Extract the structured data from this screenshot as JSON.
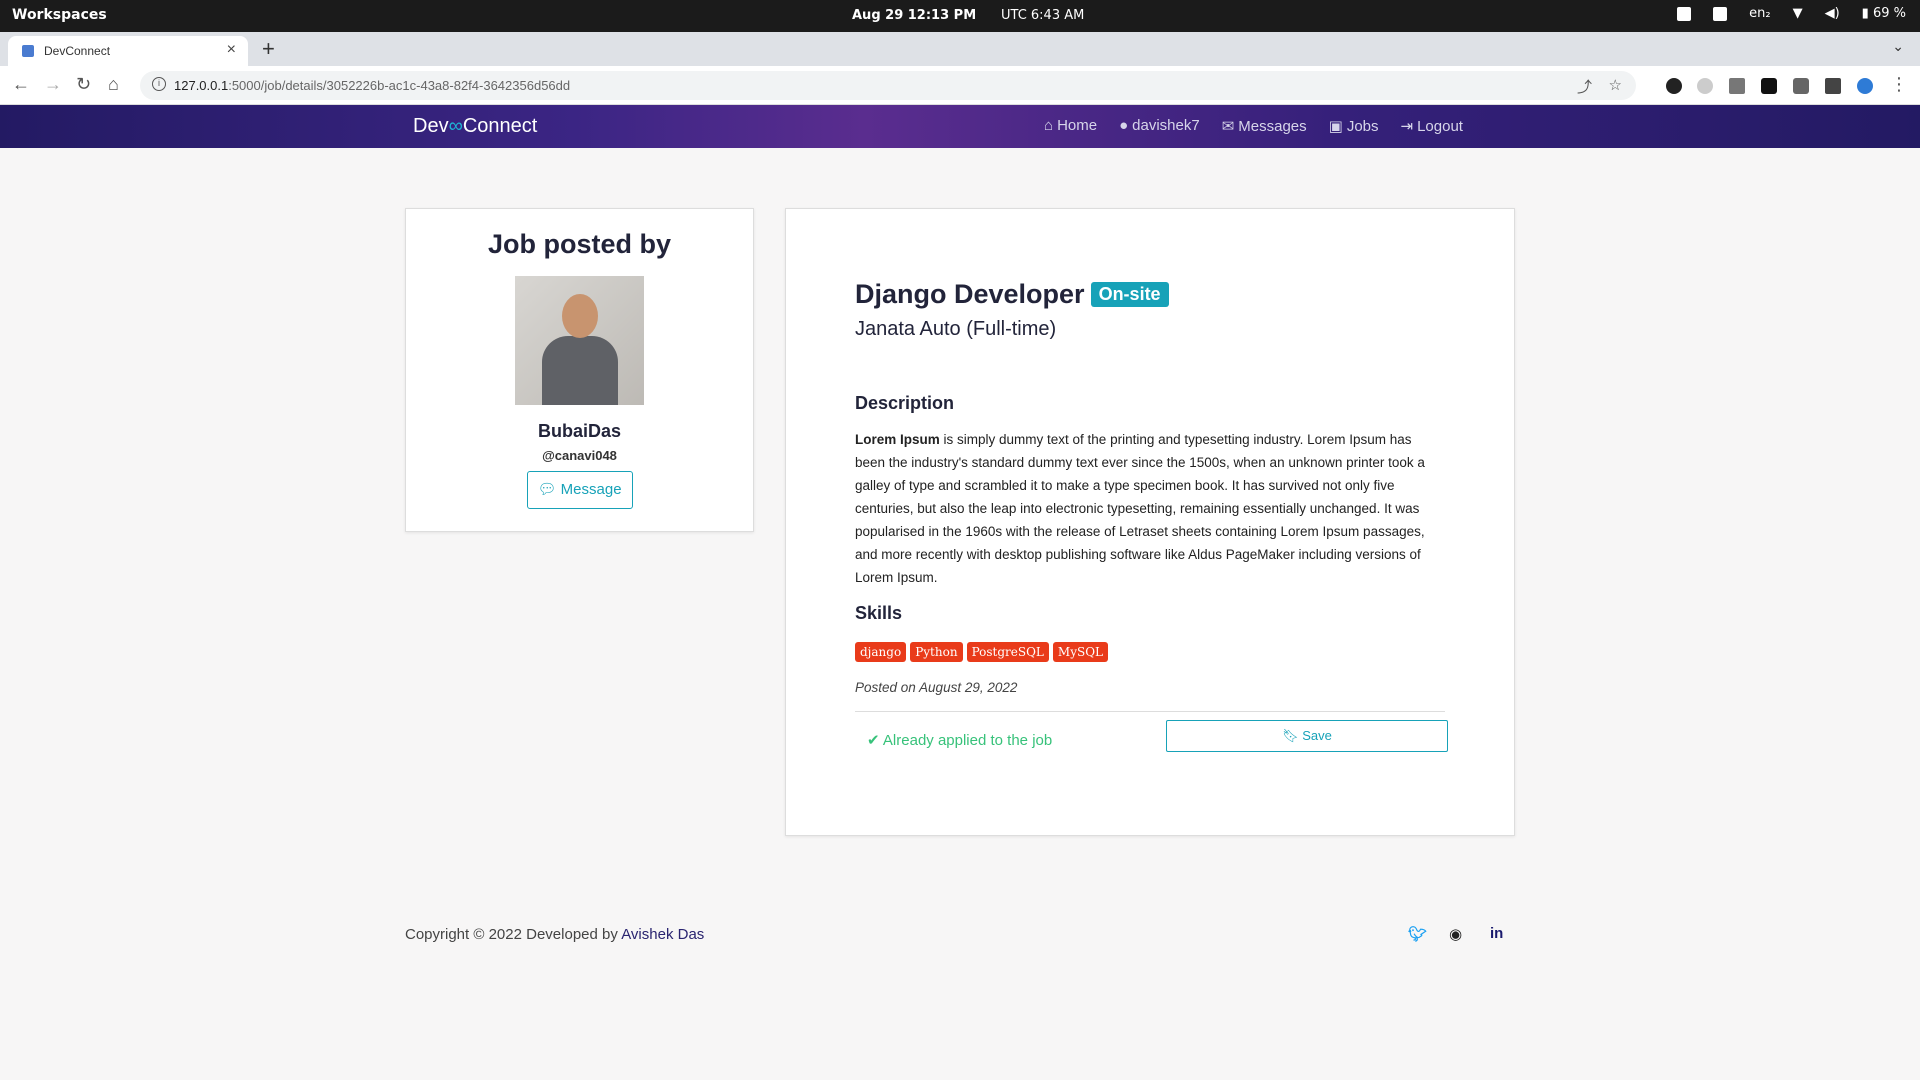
{
  "os": {
    "workspaces": "Workspaces",
    "date": "Aug 29  12:13 PM",
    "utc": "UTC 6:43 AM",
    "lang": "en₂",
    "battery": "69 %"
  },
  "browser": {
    "tab_title": "DevConnect",
    "url_host": "127.0.0.1",
    "url_rest": ":5000/job/details/3052226b-ac1c-43a8-82f4-3642356d56dd"
  },
  "site": {
    "brand_left": "Dev",
    "brand_right": "Connect",
    "nav": [
      "Home",
      "davishek7",
      "Messages",
      "Jobs",
      "Logout"
    ]
  },
  "poster": {
    "heading": "Job posted by",
    "name": "BubaiDas",
    "handle": "@canavi048",
    "message_label": "Message"
  },
  "job": {
    "title": "Django Developer",
    "work_mode": "On-site",
    "company": "Janata Auto (Full-time)",
    "description_heading": "Description",
    "description_lead": "Lorem Ipsum",
    "description_body": " is simply dummy text of the printing and typesetting industry. Lorem Ipsum has been the industry's standard dummy text ever since the 1500s, when an unknown printer took a galley of type and scrambled it to make a type specimen book. It has survived not only five centuries, but also the leap into electronic typesetting, remaining essentially unchanged. It was popularised in the 1960s with the release of Letraset sheets containing Lorem Ipsum passages, and more recently with desktop publishing software like Aldus PageMaker including versions of Lorem Ipsum.",
    "skills_heading": "Skills",
    "skills": [
      "django",
      "Python",
      "PostgreSQL",
      "MySQL"
    ],
    "posted": "Posted on August 29, 2022",
    "applied_status": "Already applied to the job",
    "save_label": "Save"
  },
  "footer": {
    "copyright": "Copyright © 2022 Developed by ",
    "author": "Avishek Das"
  },
  "colors": {
    "accent": "#17a2b8",
    "skill_badge": "#e93b1a",
    "applied": "#37c27a"
  }
}
